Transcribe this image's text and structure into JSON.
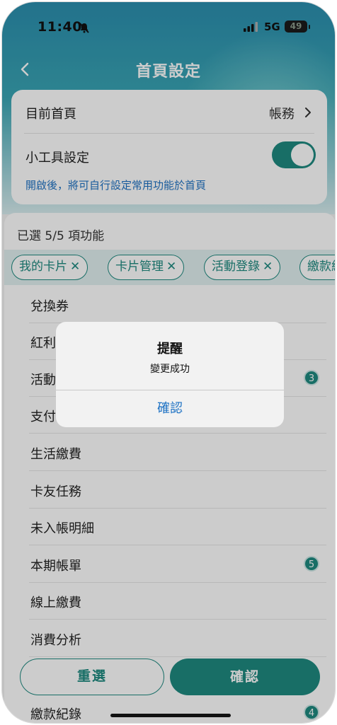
{
  "status_bar": {
    "time": "11:40",
    "network": "5G",
    "battery": "49"
  },
  "nav": {
    "title": "首頁設定"
  },
  "settings": {
    "home_label": "目前首頁",
    "home_value": "帳務",
    "widget_label": "小工具設定",
    "widget_enabled": true,
    "hint": "開啟後，將可自行設定常用功能於首頁"
  },
  "functions": {
    "selected_text": "已選 5/5 項功能",
    "chips": [
      {
        "label": "我的卡片"
      },
      {
        "label": "卡片管理"
      },
      {
        "label": "活動登錄"
      },
      {
        "label": "繳款紀"
      }
    ],
    "items": [
      {
        "label": "兌換券",
        "badge": ""
      },
      {
        "label": "紅利",
        "badge": ""
      },
      {
        "label": "活動",
        "badge": "3"
      },
      {
        "label": "支付",
        "badge": ""
      },
      {
        "label": "生活繳費",
        "badge": ""
      },
      {
        "label": "卡友任務",
        "badge": ""
      },
      {
        "label": "未入帳明細",
        "badge": ""
      },
      {
        "label": "本期帳單",
        "badge": "5"
      },
      {
        "label": "線上繳費",
        "badge": ""
      },
      {
        "label": "消費分析",
        "badge": ""
      },
      {
        "label": "繳款紀錄",
        "badge": "4"
      }
    ]
  },
  "buttons": {
    "reset": "重選",
    "confirm": "確認"
  },
  "alert": {
    "title": "提醒",
    "message": "變更成功",
    "confirm": "確認"
  },
  "colors": {
    "accent": "#1e8a80",
    "link": "#1e72c4"
  }
}
